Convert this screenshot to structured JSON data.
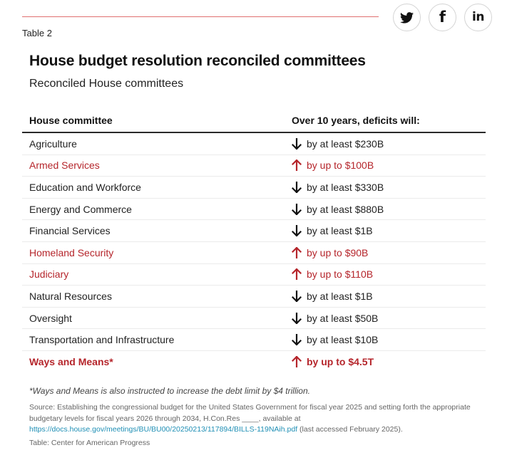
{
  "share": {
    "buttons": [
      {
        "name": "twitter",
        "icon": "twitter-bird-icon"
      },
      {
        "name": "facebook",
        "icon": "facebook-f-icon",
        "glyph": "f"
      },
      {
        "name": "linkedin",
        "icon": "linkedin-in-icon",
        "glyph": "in"
      }
    ]
  },
  "table_label": "Table 2",
  "title": "House budget resolution reconciled committees",
  "subtitle": "Reconciled House committees",
  "table": {
    "headers": [
      "House committee",
      "Over 10 years, deficits will:"
    ],
    "rows": [
      {
        "committee": "Agriculture",
        "direction": "down",
        "change": "by at least $230B"
      },
      {
        "committee": "Armed Services",
        "direction": "up",
        "change": "by up to $100B"
      },
      {
        "committee": "Education and Workforce",
        "direction": "down",
        "change": "by at least $330B"
      },
      {
        "committee": "Energy and Commerce",
        "direction": "down",
        "change": "by at least $880B"
      },
      {
        "committee": "Financial Services",
        "direction": "down",
        "change": "by at least $1B"
      },
      {
        "committee": "Homeland Security",
        "direction": "up",
        "change": "by up to $90B"
      },
      {
        "committee": "Judiciary",
        "direction": "up",
        "change": "by up to $110B"
      },
      {
        "committee": "Natural Resources",
        "direction": "down",
        "change": "by at least $1B"
      },
      {
        "committee": "Oversight",
        "direction": "down",
        "change": "by at least $50B"
      },
      {
        "committee": "Transportation and Infrastructure",
        "direction": "down",
        "change": "by at least $10B"
      },
      {
        "committee": "Ways and Means*",
        "direction": "up",
        "change": "by up to $4.5T",
        "emphasis": true
      }
    ]
  },
  "colors": {
    "accent_red": "#b5252b",
    "rule_red": "#e07070",
    "link_blue": "#1f8fb5",
    "down_arrow": "#111111"
  },
  "footnote": "*Ways and Means is also instructed to increase the debt limit by $4 trillion.",
  "source": {
    "prefix": "Source: Establishing the congressional budget for the United States Government for fiscal year 2025 and setting forth the appropriate budgetary levels for fiscal years 2026 through 2034, H.Con.Res ____, available at ",
    "link_text": "https://docs.house.gov/meetings/BU/BU00/20250213/117894/BILLS-119NAih.pdf",
    "suffix": " (last accessed February 2025)."
  },
  "credit": "Table: Center for American Progress"
}
